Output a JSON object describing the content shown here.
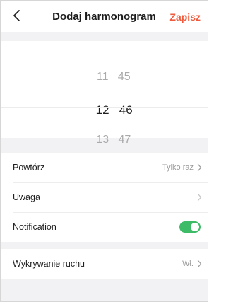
{
  "colors": {
    "accent": "#ef5b3c",
    "toggle_on": "#3dbb67",
    "background": "#f2f2f4",
    "card": "#ffffff",
    "muted_text": "#9a9a9a"
  },
  "header": {
    "back_icon": "chevron-left-icon",
    "title": "Dodaj harmonogram",
    "save_label": "Zapisz"
  },
  "time_picker": {
    "rows": [
      {
        "hour": "11",
        "minute": "45",
        "selected": false
      },
      {
        "hour": "12",
        "minute": "46",
        "selected": true
      },
      {
        "hour": "13",
        "minute": "47",
        "selected": false
      }
    ]
  },
  "settings": {
    "repeat": {
      "label": "Powtórz",
      "value": "Tylko raz",
      "icon": "chevron-right-icon"
    },
    "note": {
      "label": "Uwaga",
      "value": "",
      "icon": "chevron-right-icon"
    },
    "notification": {
      "label": "Notification",
      "enabled": true
    }
  },
  "motion": {
    "label": "Wykrywanie ruchu",
    "value": "Wł.",
    "icon": "chevron-right-icon"
  }
}
